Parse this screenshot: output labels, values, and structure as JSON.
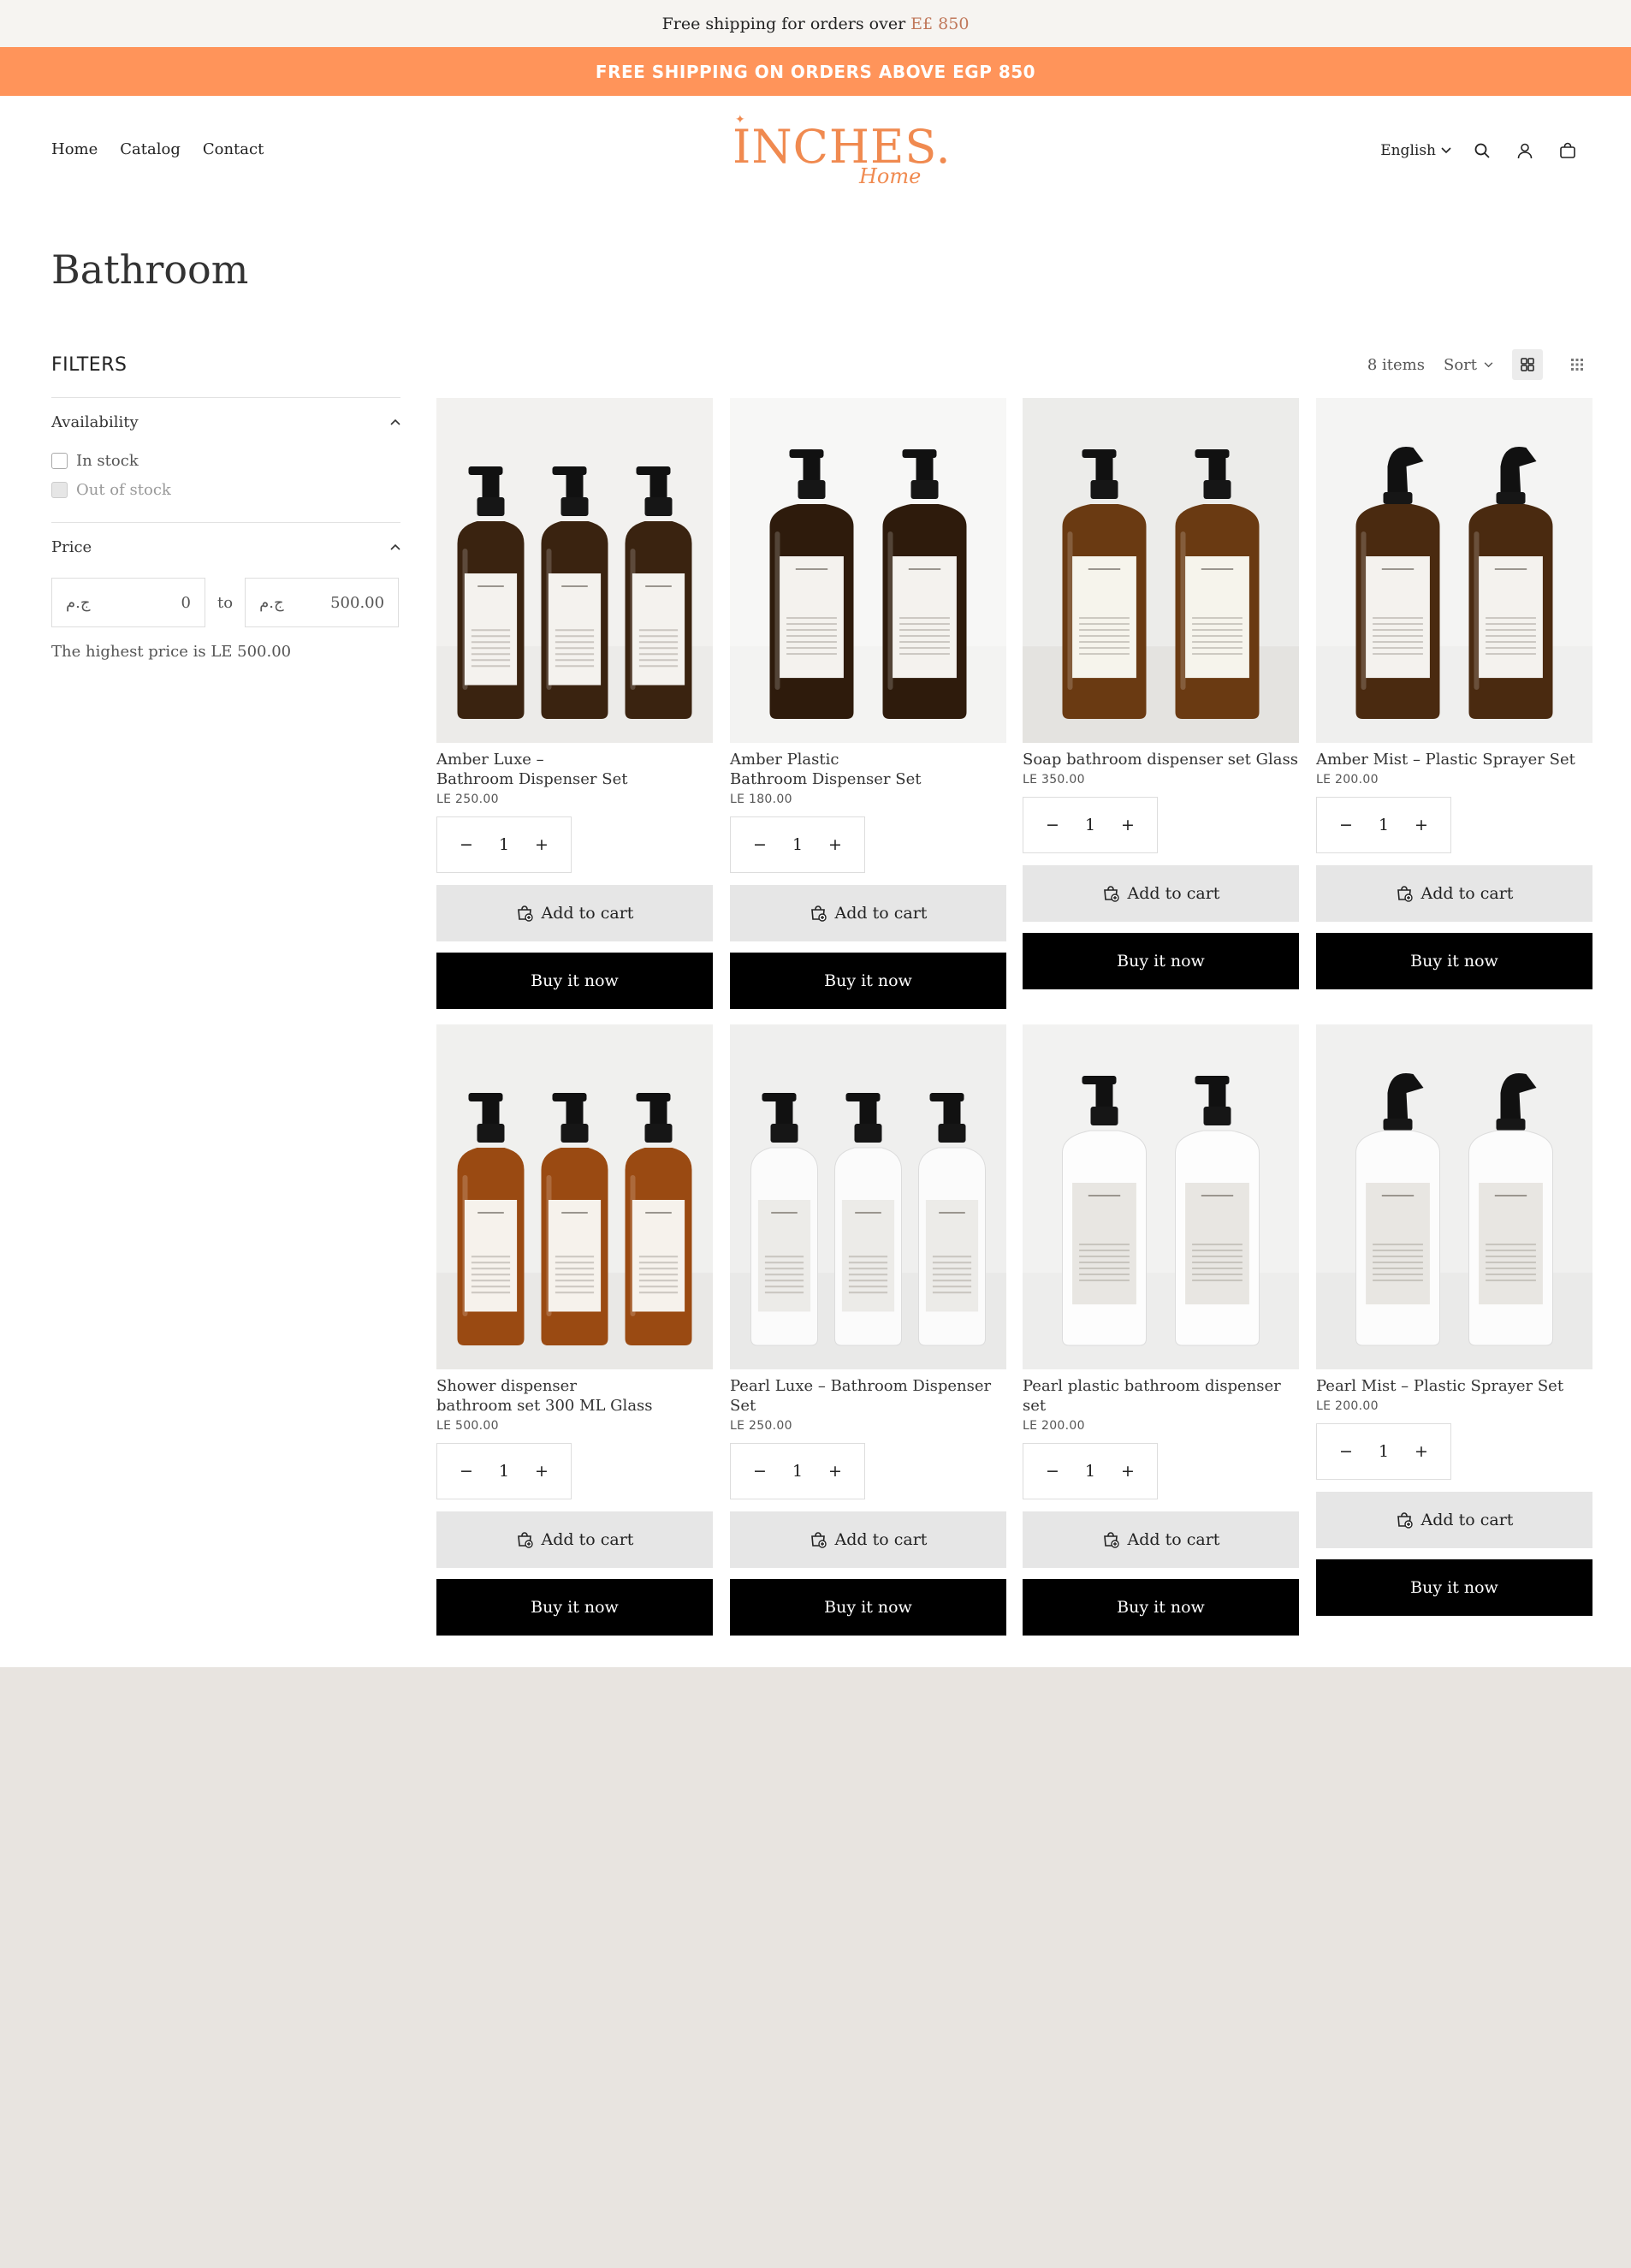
{
  "announcement": {
    "text": "Free shipping for orders over",
    "amount": "E£ 850",
    "banner": "FREE SHIPPING ON ORDERS ABOVE EGP 850"
  },
  "nav": [
    "Home",
    "Catalog",
    "Contact"
  ],
  "logo": {
    "main": "INCHES.",
    "sub": "Home"
  },
  "header": {
    "language": "English"
  },
  "page_title": "Bathroom",
  "filters": {
    "title": "FILTERS",
    "availability": {
      "label": "Availability",
      "options": [
        "In stock",
        "Out of stock"
      ]
    },
    "price": {
      "label": "Price",
      "currency": "ج.م",
      "from_value": "0",
      "to_label": "to",
      "to_value": "500.00",
      "note": "The highest price is LE 500.00"
    }
  },
  "toolbar": {
    "count": "8 items",
    "sort": "Sort"
  },
  "buttons": {
    "add_to_cart": "Add to cart",
    "buy_now": "Buy it now"
  },
  "products": [
    {
      "name1": "Amber Luxe –",
      "name2": "Bathroom Dispenser Set",
      "price": "LE 250.00",
      "qty": "1",
      "image": "amber-pump-trio"
    },
    {
      "name1": "Amber Plastic",
      "name2": "Bathroom Dispenser Set",
      "price": "LE 180.00",
      "qty": "1",
      "image": "amber-pump-duo"
    },
    {
      "name1": "Soap bathroom dispenser set Glass",
      "name2": "",
      "price": "LE 350.00",
      "qty": "1",
      "image": "amber-glass-duo"
    },
    {
      "name1": "Amber Mist – Plastic Sprayer Set",
      "name2": "",
      "price": "LE 200.00",
      "qty": "1",
      "image": "amber-sprayer-duo"
    },
    {
      "name1": "Shower dispenser",
      "name2": "bathroom set 300 ML Glass",
      "price": "LE 500.00",
      "qty": "1",
      "image": "amber-glass-trio"
    },
    {
      "name1": "Pearl Luxe – Bathroom Dispenser Set",
      "name2": "",
      "price": "LE 250.00",
      "qty": "1",
      "image": "white-pump-trio"
    },
    {
      "name1": "Pearl plastic bathroom dispenser set",
      "name2": "",
      "price": "LE 200.00",
      "qty": "1",
      "image": "white-pump-duo"
    },
    {
      "name1": "Pearl Mist – Plastic Sprayer Set",
      "name2": "",
      "price": "LE 200.00",
      "qty": "1",
      "image": "white-sprayer-duo"
    }
  ],
  "colors": {
    "accent": "#ff945a",
    "logo": "#f08a50",
    "button_dark": "#000000",
    "button_light": "#e6e6e6"
  }
}
